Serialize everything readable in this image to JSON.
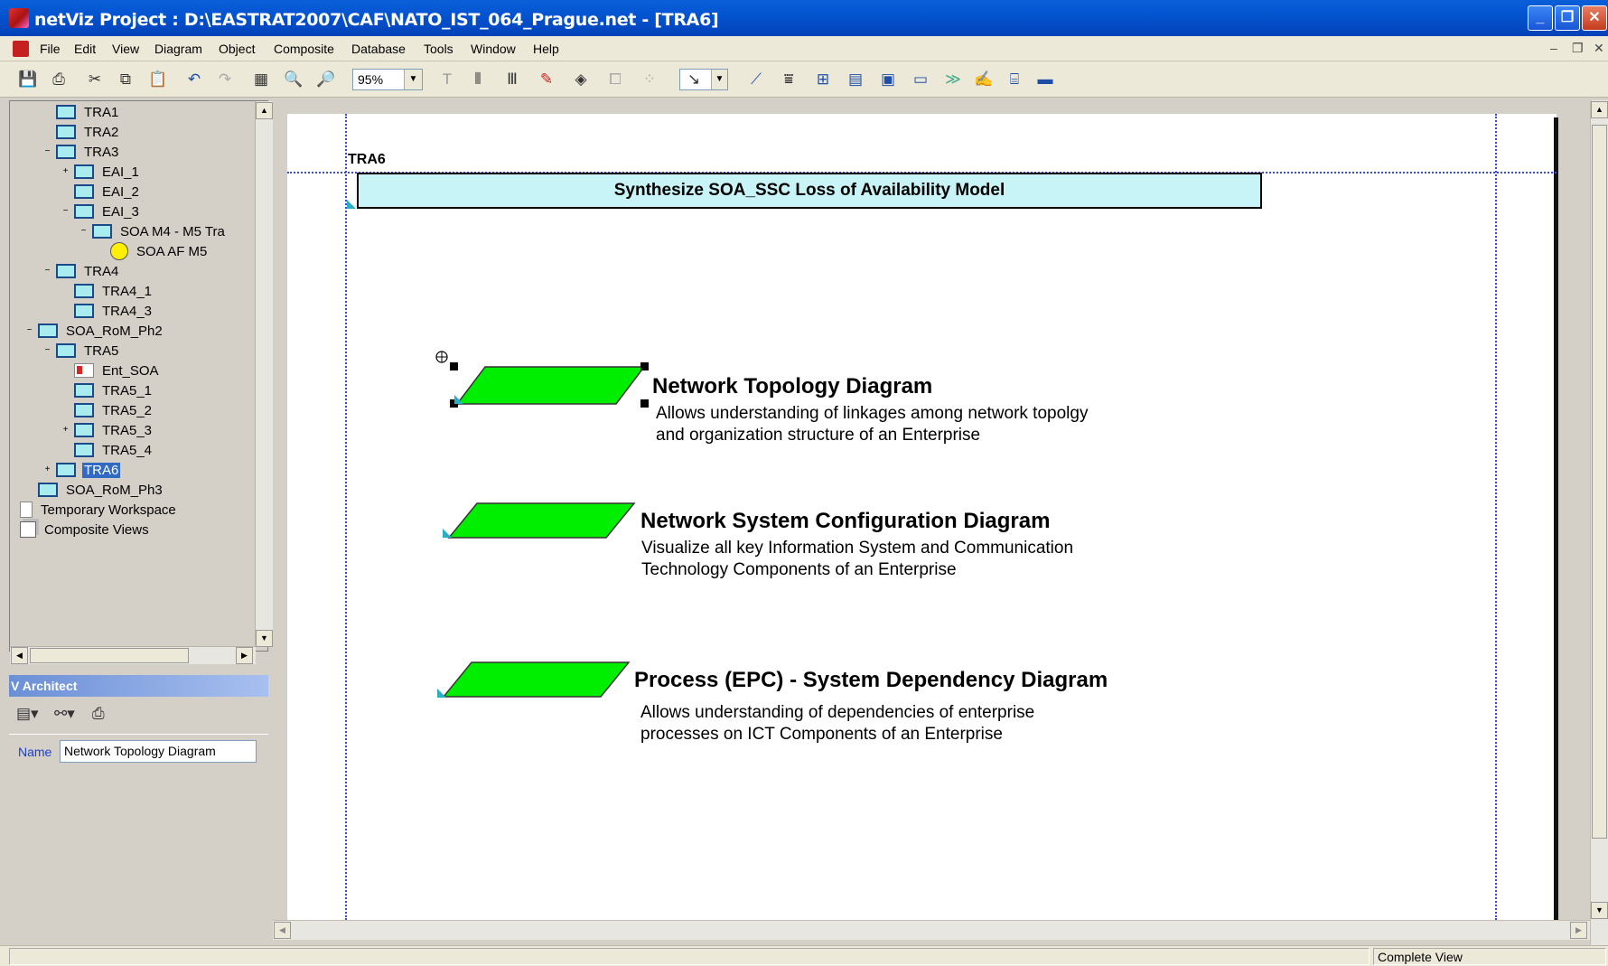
{
  "window": {
    "title": "netViz Project : D:\\EASTRAT2007\\CAF\\NATO_IST_064_Prague.net - [TRA6]",
    "minimize_glyph": "_",
    "restore_glyph": "❐",
    "close_glyph": "✕"
  },
  "menu": {
    "items": [
      "File",
      "Edit",
      "View",
      "Diagram",
      "Object",
      "Composite",
      "Database",
      "Tools",
      "Window",
      "Help"
    ],
    "mdi_min": "–",
    "mdi_restore": "❐",
    "mdi_close": "✕"
  },
  "toolbar": {
    "zoom_value": "95%",
    "icons": [
      "save-icon",
      "print-icon",
      "cut-icon",
      "copy-icon",
      "paste-icon",
      "undo-icon",
      "redo-icon",
      "fit-page-icon",
      "zoom-in-icon",
      "zoom-out-icon",
      "text-icon",
      "align-icon",
      "distribute-icon",
      "line-color-icon",
      "fill-color-icon",
      "tree-layout-icon",
      "network-layout-icon",
      "pointer-icon",
      "link-tool-icon",
      "hierarchy-icon",
      "organization-icon",
      "table-view-icon",
      "form-view-icon",
      "summary-icon",
      "flow-icon",
      "edit-form-icon",
      "network-icon",
      "monitor-icon"
    ]
  },
  "tree": {
    "items": [
      {
        "label": "TRA1",
        "icon": "screen"
      },
      {
        "label": "TRA2",
        "icon": "screen"
      },
      {
        "label": "TRA3",
        "icon": "screen",
        "expander": "−"
      },
      {
        "label": "EAI_1",
        "icon": "screen",
        "expander": "+"
      },
      {
        "label": "EAI_2",
        "icon": "screen"
      },
      {
        "label": "EAI_3",
        "icon": "screen",
        "expander": "−"
      },
      {
        "label": "SOA M4 - M5 Tra",
        "icon": "screen",
        "expander": "−"
      },
      {
        "label": "SOA AF M5",
        "icon": "circle"
      },
      {
        "label": "TRA4",
        "icon": "screen",
        "expander": "−"
      },
      {
        "label": "TRA4_1",
        "icon": "screen"
      },
      {
        "label": "TRA4_3",
        "icon": "screen"
      },
      {
        "label": "SOA_RoM_Ph2",
        "icon": "screen",
        "expander": "−"
      },
      {
        "label": "TRA5",
        "icon": "screen",
        "expander": "−"
      },
      {
        "label": "Ent_SOA",
        "icon": "entity"
      },
      {
        "label": "TRA5_1",
        "icon": "screen"
      },
      {
        "label": "TRA5_2",
        "icon": "screen"
      },
      {
        "label": "TRA5_3",
        "icon": "screen",
        "expander": "+"
      },
      {
        "label": "TRA5_4",
        "icon": "screen"
      },
      {
        "label": "TRA6",
        "icon": "screen",
        "expander": "+",
        "selected": true
      },
      {
        "label": "SOA_RoM_Ph3",
        "icon": "screen"
      },
      {
        "label": "Temporary Workspace",
        "icon": "page"
      },
      {
        "label": "Composite Views",
        "icon": "composite"
      }
    ]
  },
  "architect": {
    "header": "V Architect",
    "name_label": "Name",
    "name_value": "Network Topology Diagram"
  },
  "diagram": {
    "container_label": "TRA6",
    "container_title": "Synthesize SOA_SSC Loss of Availability Model",
    "items": [
      {
        "title": "Network Topology Diagram",
        "desc_line1": "Allows understanding of linkages among network topolgy",
        "desc_line2": "and organization structure of an Enterprise",
        "fill": "#00ee00",
        "selected": true
      },
      {
        "title": "Network System  Configuration Diagram",
        "desc_line1": "Visualize all key Information System and Communication",
        "desc_line2": "Technology Components of an Enterprise",
        "fill": "#00ee00"
      },
      {
        "title": "Process (EPC) - System Dependency Diagram",
        "desc_line1": "Allows understanding of dependencies of enterprise",
        "desc_line2": "processes on ICT Components of an Enterprise",
        "fill": "#00ee00"
      }
    ]
  },
  "status": {
    "view_mode": "Complete View"
  },
  "colors": {
    "titlebar": "#0454d1",
    "selection": "#316ac5",
    "container_fill": "#c8f4f7",
    "shape_fill": "#00ee00",
    "guide": "#3a4ad8"
  }
}
